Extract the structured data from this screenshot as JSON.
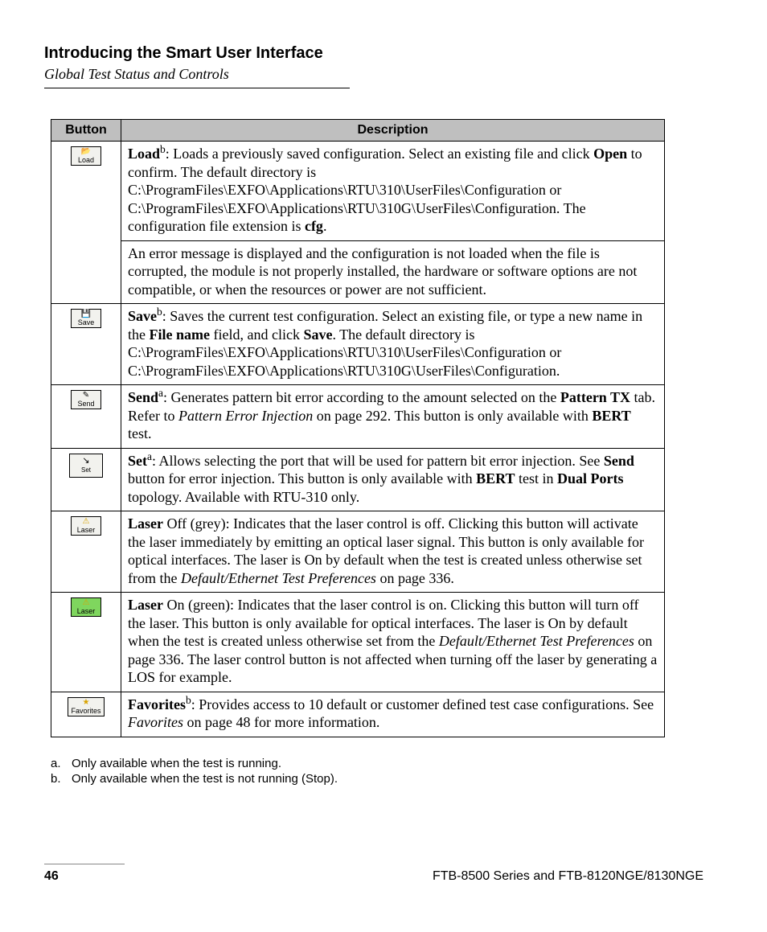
{
  "header": {
    "section_title": "Introducing the Smart User Interface",
    "section_sub": "Global Test Status and Controls"
  },
  "table": {
    "col_button": "Button",
    "col_description": "Description"
  },
  "buttons": {
    "load": "Load",
    "save": "Save",
    "send": "Send",
    "set": "Set",
    "laser": "Laser",
    "favorites": "Favorites"
  },
  "rows": {
    "load": {
      "lead": "Load",
      "sup": "b",
      "p1a": ": Loads a previously saved configuration. Select an existing file and click ",
      "open": "Open",
      "p1b": " to confirm. The default directory is C:\\ProgramFiles\\EXFO\\Applications\\RTU\\310\\UserFiles\\Configuration or C:\\ProgramFiles\\EXFO\\Applications\\RTU\\310G\\UserFiles\\Configuration. The configuration file extension is ",
      "cfg": "cfg",
      "p1c": ".",
      "p2": "An error message is displayed and the configuration is not loaded when the file is corrupted, the module is not properly installed, the hardware or software options are not compatible, or when the resources or power are not sufficient."
    },
    "save": {
      "lead": "Save",
      "sup": "b",
      "p1a": ": Saves the current test configuration. Select an existing file, or type a new name in the ",
      "filename": "File name",
      "p1b": " field, and click ",
      "savebtn": "Save",
      "p1c": ". The default directory is C:\\ProgramFiles\\EXFO\\Applications\\RTU\\310\\UserFiles\\Configuration or C:\\ProgramFiles\\EXFO\\Applications\\RTU\\310G\\UserFiles\\Configuration."
    },
    "send": {
      "lead": "Send",
      "sup": "a",
      "p1a": ": Generates pattern bit error according to the amount selected on the ",
      "ptx": "Pattern TX",
      "p1b": " tab. Refer to ",
      "ref": "Pattern Error Injection",
      "p1c": " on page 292. This button is only available with ",
      "bert": "BERT",
      "p1d": " test."
    },
    "set": {
      "lead": "Set",
      "sup": "a",
      "p1a": ": Allows selecting the port that will be used for pattern bit error injection. See ",
      "sendb": "Send",
      "p1b": " button for error injection. This button is only available with ",
      "bert": "BERT",
      "p1c": " test in ",
      "dual": "Dual Ports",
      "p1d": " topology. Available with RTU-310 only."
    },
    "laser_off": {
      "lead": "Laser",
      "p1a": " Off (grey): Indicates that the laser control is off. Clicking this button will activate the laser immediately by emitting an optical laser signal. This button is only available for optical interfaces. The laser is On by default when the test is created unless otherwise set from the ",
      "ref": "Default/Ethernet Test Preferences",
      "p1b": " on page 336."
    },
    "laser_on": {
      "lead": "Laser",
      "p1a": " On (green): Indicates that the laser control is on. Clicking this button will turn off the laser. This button is only available for optical interfaces. The laser is On by default when the test is created unless otherwise set from the ",
      "ref": "Default/Ethernet Test Preferences",
      "p1b": " on page 336. The laser control button is not affected when turning off the laser by generating a LOS for example."
    },
    "favorites": {
      "lead": "Favorites",
      "sup": "b",
      "p1a": ": Provides access to 10 default or customer defined test case configurations. See ",
      "ref": "Favorites",
      "p1b": " on page 48 for more information."
    }
  },
  "footnotes": {
    "a_label": "a.",
    "a_text": "Only available when the test is running.",
    "b_label": "b.",
    "b_text": "Only available when the test is not running (Stop)."
  },
  "footer": {
    "page_number": "46",
    "product": "FTB-8500 Series and FTB-8120NGE/8130NGE"
  }
}
